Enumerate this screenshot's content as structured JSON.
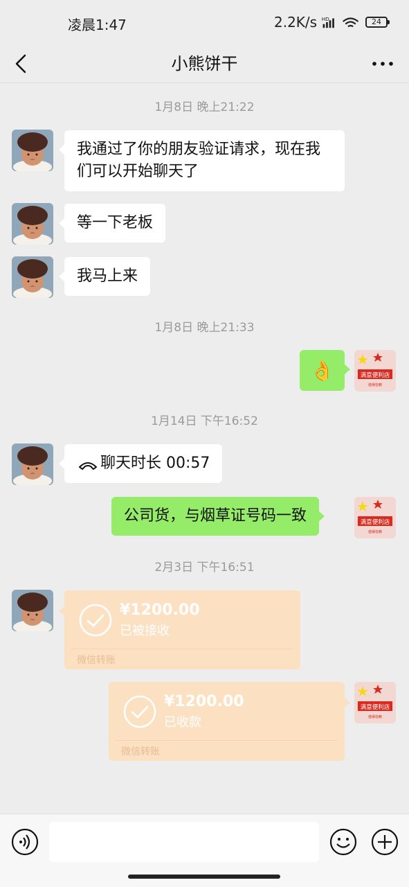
{
  "status": {
    "time": "凌晨1:47",
    "speed": "2.2K/s",
    "network": "HD",
    "battery": "24"
  },
  "header": {
    "title": "小熊饼干"
  },
  "messages": {
    "time1": "1月8日 晚上21:22",
    "msg1": "我通过了你的朋友验证请求，现在我们可以开始聊天了",
    "msg2": "等一下老板",
    "msg3": "我马上来",
    "time2": "1月8日 晚上21:33",
    "msg4_emoji": "👌",
    "time3": "1月14日 下午16:52",
    "call": "聊天时长 00:57",
    "msg5": "公司货，与烟草证号码一致",
    "time4": "2月3日 下午16:51",
    "transfer1": {
      "amount": "¥1200.00",
      "status": "已被接收",
      "footer": "微信转账"
    },
    "transfer2": {
      "amount": "¥1200.00",
      "status": "已收款",
      "footer": "微信转账"
    }
  },
  "self_avatar": {
    "shop_name": "满意便利店",
    "subtitle": "值得信赖"
  },
  "colors": {
    "background": "#ededed",
    "bubble_out": "#95ec69",
    "bubble_in": "#ffffff",
    "transfer": "#fce0c2"
  },
  "input": {
    "value": "",
    "placeholder": ""
  }
}
